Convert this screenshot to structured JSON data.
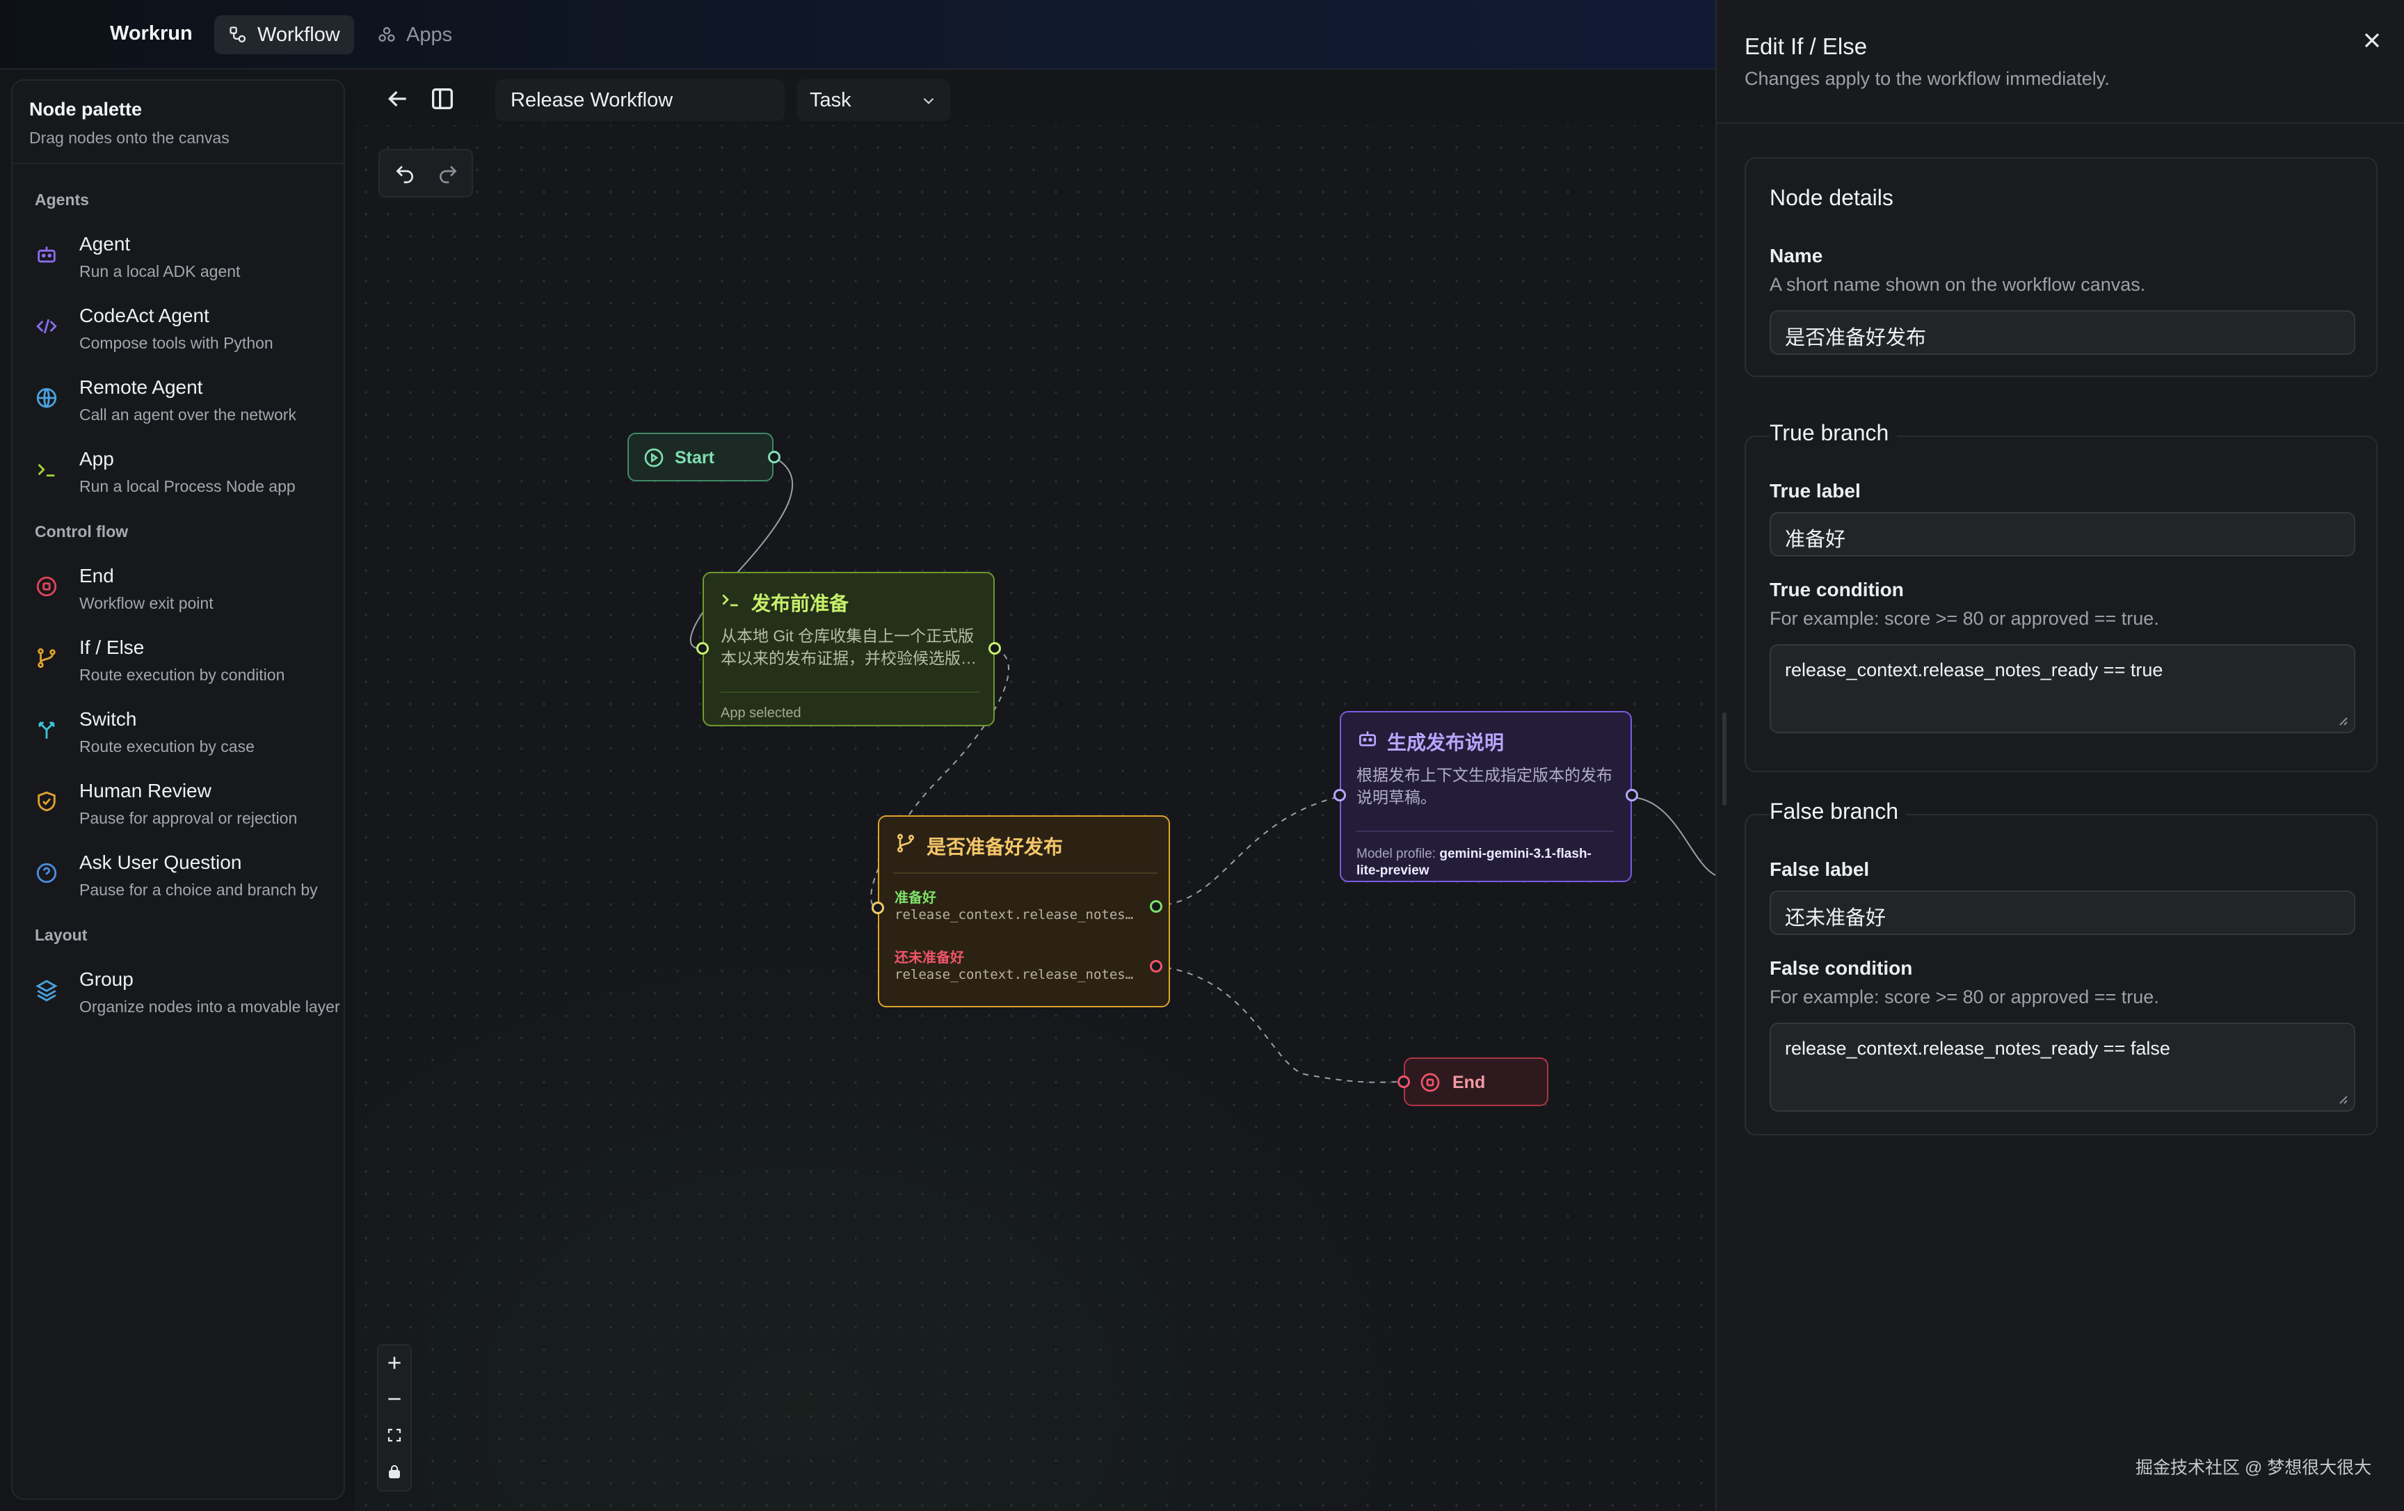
{
  "topbar": {
    "brand": "Workrun",
    "nav": [
      {
        "label": "Workflow",
        "icon": "workflow-icon",
        "active": true
      },
      {
        "label": "Apps",
        "icon": "apps-icon",
        "active": false
      }
    ]
  },
  "palette": {
    "title": "Node palette",
    "subtitle": "Drag nodes onto the canvas",
    "sections": [
      {
        "label": "Agents"
      },
      {
        "label": "Control flow"
      },
      {
        "label": "Layout"
      }
    ],
    "items": [
      {
        "name": "Agent",
        "desc": "Run a local ADK agent",
        "icon": "bot-icon",
        "color": "#8b6cf0"
      },
      {
        "name": "CodeAct Agent",
        "desc": "Compose tools with Python",
        "icon": "code-icon",
        "color": "#8b6cf0"
      },
      {
        "name": "Remote Agent",
        "desc": "Call an agent over the network",
        "icon": "globe-icon",
        "color": "#4aa3e0"
      },
      {
        "name": "App",
        "desc": "Run a local Process Node app",
        "icon": "terminal-icon",
        "color": "#a5d63a"
      },
      {
        "name": "End",
        "desc": "Workflow exit point",
        "icon": "stop-icon",
        "color": "#e0455a"
      },
      {
        "name": "If / Else",
        "desc": "Route execution by condition",
        "icon": "branch-icon",
        "color": "#e0a22e"
      },
      {
        "name": "Switch",
        "desc": "Route execution by case",
        "icon": "switch-icon",
        "color": "#3fc4d8"
      },
      {
        "name": "Human Review",
        "desc": "Pause for approval or rejection",
        "icon": "shield-icon",
        "color": "#e0a22e"
      },
      {
        "name": "Ask User Question",
        "desc": "Pause for a choice and branch by",
        "icon": "question-icon",
        "color": "#4a8de0"
      },
      {
        "name": "Group",
        "desc": "Organize nodes into a movable layer",
        "icon": "layers-icon",
        "color": "#4aa3e0"
      }
    ]
  },
  "toolbar": {
    "workflow_name": "Release Workflow",
    "workflow_type": "Task"
  },
  "canvas": {
    "nodes": {
      "start": {
        "label": "Start"
      },
      "prep": {
        "title": "发布前准备",
        "desc": "从本地 Git 仓库收集自上一个正式版本以来的发布证据，并校验候选版…",
        "footer": "App selected"
      },
      "cond": {
        "title": "是否准备好发布",
        "true_label": "准备好",
        "true_cond": "release_context.release_notes…",
        "false_label": "还未准备好",
        "false_cond": "release_context.release_notes…"
      },
      "gen": {
        "title": "生成发布说明",
        "desc": "根据发布上下文生成指定版本的发布说明草稿。",
        "profile_label": "Model profile:",
        "profile_value": "gemini-gemini-3.1-flash-lite-preview"
      },
      "end": {
        "label": "End"
      }
    },
    "colors": {
      "start": "#3f8a67",
      "prep": "#6f9a2c",
      "cond": "#e0a22e",
      "gen": "#7b5ce0",
      "end": "#b03344"
    }
  },
  "panel": {
    "title": "Edit If / Else",
    "subtitle": "Changes apply to the workflow immediately.",
    "details": {
      "heading": "Node details",
      "name_label": "Name",
      "name_help": "A short name shown on the workflow canvas.",
      "name_value": "是否准备好发布"
    },
    "true_branch": {
      "heading": "True branch",
      "label_label": "True label",
      "label_value": "准备好",
      "cond_label": "True condition",
      "cond_help": "For example: score >= 80 or approved == true.",
      "cond_value": "release_context.release_notes_ready == true"
    },
    "false_branch": {
      "heading": "False branch",
      "label_label": "False label",
      "label_value": "还未准备好",
      "cond_label": "False condition",
      "cond_help": "For example: score >= 80 or approved == true.",
      "cond_value": "release_context.release_notes_ready == false"
    }
  },
  "watermark": "掘金技术社区 @ 梦想很大很大"
}
